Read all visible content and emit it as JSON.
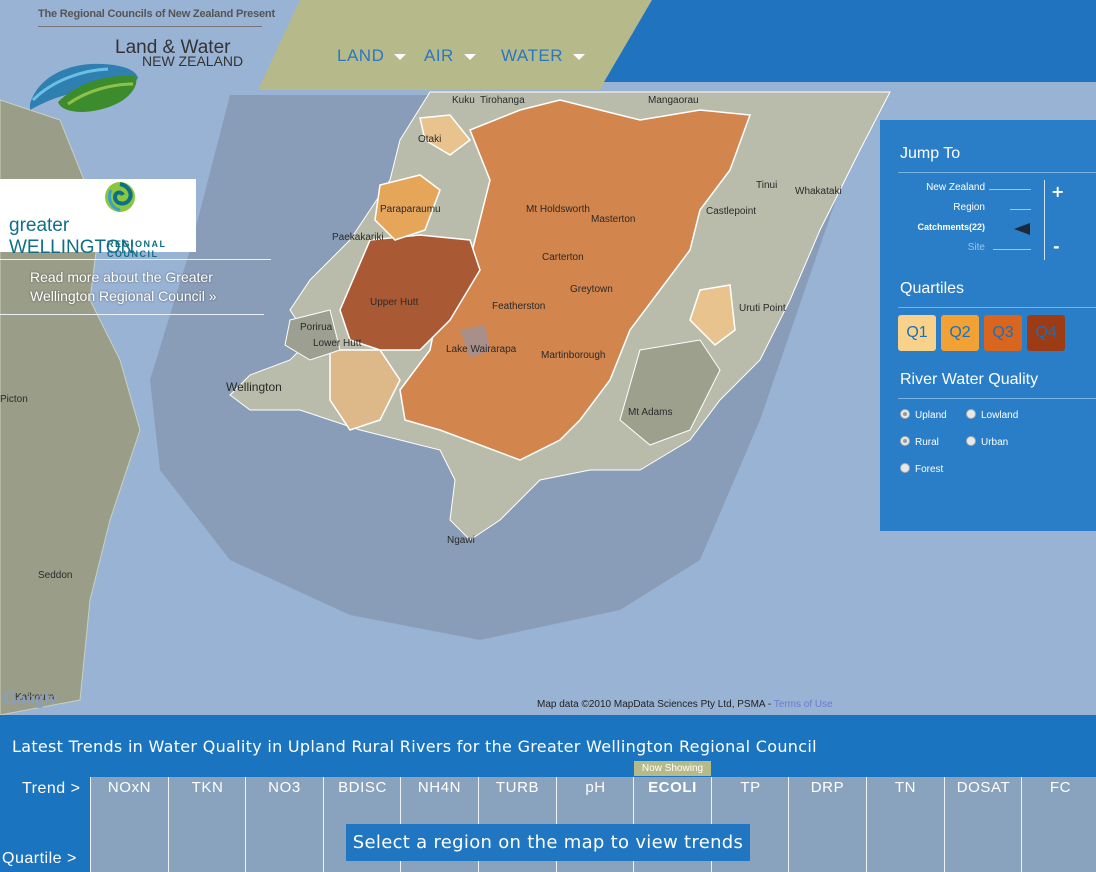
{
  "header": {
    "presenter": "The Regional Councils of New Zealand Present",
    "title_line1": "Land & Water",
    "title_line2": "NEW ZEALAND",
    "nav": [
      {
        "label": "LAND"
      },
      {
        "label": "AIR"
      },
      {
        "label": "WATER"
      }
    ]
  },
  "council": {
    "logo_name": "greater WELLINGTON",
    "logo_sub": "REGIONAL COUNCIL",
    "read_more": "Read more about the Greater Wellington Regional Council »"
  },
  "map": {
    "place_labels": [
      {
        "text": "Kuku"
      },
      {
        "text": "Tirohanga"
      },
      {
        "text": "Mangaorau"
      },
      {
        "text": "Otaki"
      },
      {
        "text": "Paraparaumu"
      },
      {
        "text": "Paekakariki"
      },
      {
        "text": "Mt Holdsworth"
      },
      {
        "text": "Masterton"
      },
      {
        "text": "Carterton"
      },
      {
        "text": "Greytown"
      },
      {
        "text": "Upper Hutt"
      },
      {
        "text": "Featherston"
      },
      {
        "text": "Porirua"
      },
      {
        "text": "Lower Hutt"
      },
      {
        "text": "Wellington"
      },
      {
        "text": "Martinborough"
      },
      {
        "text": "Lake Wairarapa"
      },
      {
        "text": "Tinui"
      },
      {
        "text": "Whakataki"
      },
      {
        "text": "Castlepoint"
      },
      {
        "text": "Uruti Point"
      },
      {
        "text": "Mt Adams"
      },
      {
        "text": "Ngawi"
      },
      {
        "text": "Picton"
      },
      {
        "text": "Seddon"
      },
      {
        "text": "Kaikoura"
      }
    ],
    "attribution": "Map data ©2010  MapData Sciences Pty Ltd, PSMA -",
    "terms": "Terms of Use",
    "provider": "Google"
  },
  "panel": {
    "jump_to": "Jump To",
    "zoom_levels": [
      "New Zealand",
      "Region",
      "Catchments(22)",
      "Site"
    ],
    "zoom_selected": "Catchments(22)",
    "zoom_in": "+",
    "zoom_out": "-",
    "quartiles_title": "Quartiles",
    "quartiles": [
      {
        "label": "Q1",
        "color": "#f8d28a",
        "text": "#1e6fb7"
      },
      {
        "label": "Q2",
        "color": "#f2a234",
        "text": "#1e6fb7"
      },
      {
        "label": "Q3",
        "color": "#d8661e",
        "text": "#1e6fb7"
      },
      {
        "label": "Q4",
        "color": "#9c3b14",
        "text": "#1e6fb7"
      }
    ],
    "river_quality_title": "River Water Quality",
    "river_options": [
      {
        "label": "Upland",
        "checked": true
      },
      {
        "label": "Lowland",
        "checked": false
      },
      {
        "label": "Rural",
        "checked": true
      },
      {
        "label": "Urban",
        "checked": false
      },
      {
        "label": "Forest",
        "checked": false
      }
    ]
  },
  "trends": {
    "headline": "Latest Trends in Water Quality in Upland Rural Rivers for the Greater Wellington Regional Council",
    "trend_label": "Trend >",
    "quartile_label": "Quartile >",
    "now_showing": "Now Showing",
    "active": "ECOLI",
    "columns": [
      "NOxN",
      "TKN",
      "NO3",
      "BDISC",
      "NH4N",
      "TURB",
      "pH",
      "ECOLI",
      "TP",
      "DRP",
      "TN",
      "DOSAT",
      "FC"
    ],
    "message": "Select a region on the map to view trends"
  }
}
